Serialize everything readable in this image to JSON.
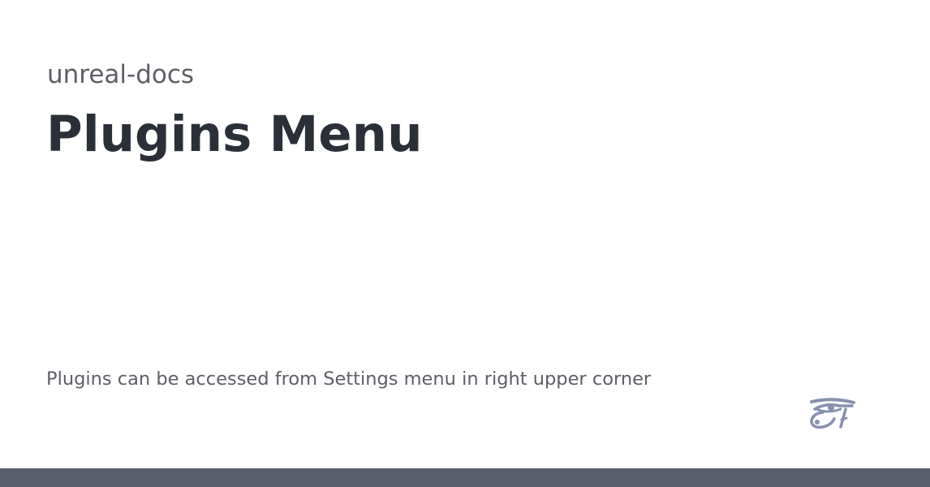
{
  "card": {
    "site_name": "unreal-docs",
    "title": "Plugins Menu",
    "description": "Plugins can be accessed from Settings menu in right upper corner"
  },
  "icons": {
    "logo": "eye-of-horus-icon"
  },
  "colors": {
    "background": "#ffffff",
    "site_name": "#5c5f66",
    "title": "#2b3038",
    "description": "#5c5f66",
    "logo": "#8791ad",
    "footer_bar": "#5a5f6b"
  }
}
